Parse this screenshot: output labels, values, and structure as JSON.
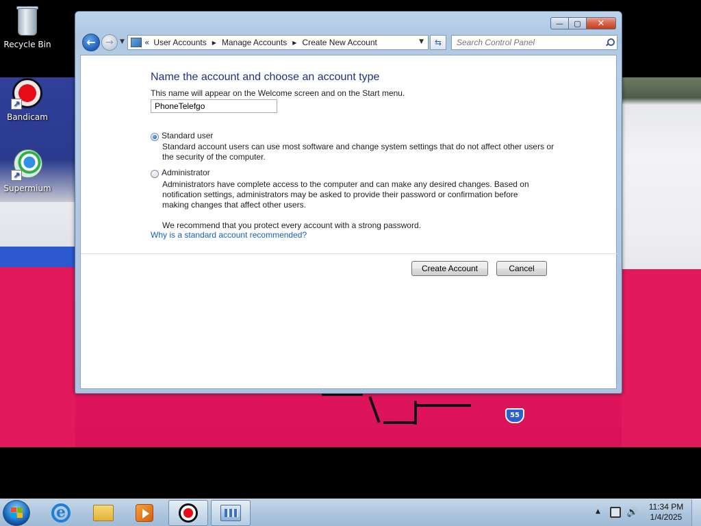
{
  "desktop": {
    "icons": [
      {
        "label": "Recycle Bin"
      },
      {
        "label": "Bandicam"
      },
      {
        "label": "Supermium"
      }
    ],
    "wallpaper_shield_text": "55"
  },
  "window": {
    "controls": {
      "minimize": "—",
      "maximize": "▢",
      "close": "✕"
    },
    "address": {
      "chevron": "«",
      "crumbs": [
        "User Accounts",
        "Manage Accounts",
        "Create New Account"
      ],
      "separator": "▶"
    },
    "search": {
      "placeholder": "Search Control Panel"
    },
    "content": {
      "heading": "Name the account and choose an account type",
      "subtext": "This name will appear on the Welcome screen and on the Start menu.",
      "name_value": "PhoneTelefgo",
      "options": [
        {
          "label": "Standard user",
          "selected": true,
          "description": "Standard account users can use most software and change system settings that do not affect other users or the security of the computer."
        },
        {
          "label": "Administrator",
          "selected": false,
          "description": "Administrators have complete access to the computer and can make any desired changes. Based on notification settings, administrators may be asked to provide their password or confirmation before making changes that affect other users."
        }
      ],
      "recommendation": "We recommend that you protect every account with a strong password.",
      "help_link": "Why is a standard account recommended?",
      "buttons": {
        "create": "Create Account",
        "cancel": "Cancel"
      }
    }
  },
  "taskbar": {
    "items": [
      "internet-explorer",
      "windows-explorer",
      "media-player",
      "bandicam",
      "control-panel"
    ],
    "clock": {
      "time": "11:34 PM",
      "date": "1/4/2025"
    }
  },
  "colors": {
    "heading": "#1e3287",
    "link": "#1560bd",
    "close_button": "#c1401f"
  }
}
